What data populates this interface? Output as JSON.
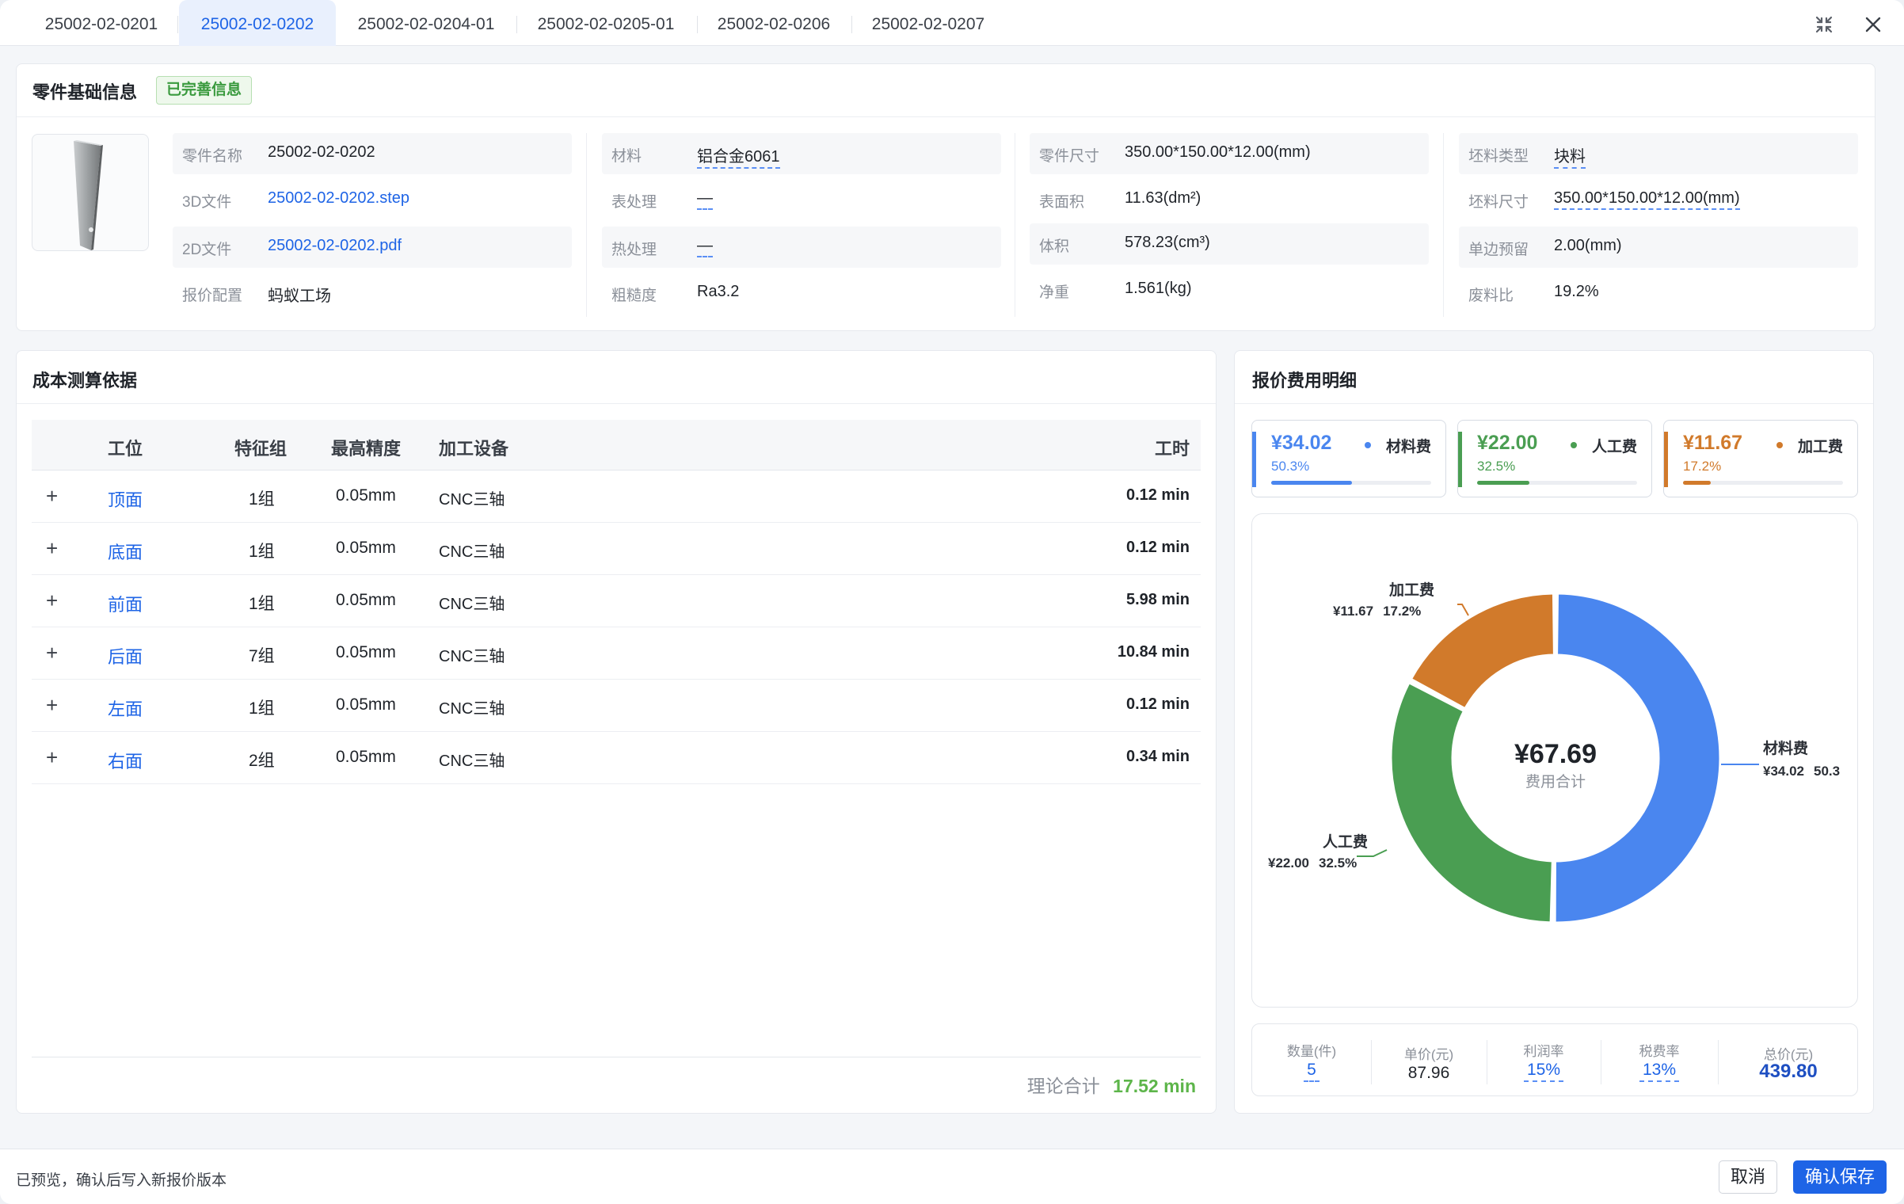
{
  "tabs": [
    {
      "label": "25002-02-0201",
      "active": false
    },
    {
      "label": "25002-02-0202",
      "active": true
    },
    {
      "label": "25002-02-0204-01",
      "active": false
    },
    {
      "label": "25002-02-0205-01",
      "active": false
    },
    {
      "label": "25002-02-0206",
      "active": false
    },
    {
      "label": "25002-02-0207",
      "active": false
    }
  ],
  "basic_info": {
    "title": "零件基础信息",
    "status_badge": "已完善信息",
    "part_name_label": "零件名称",
    "part_name": "25002-02-0202",
    "file3d_label": "3D文件",
    "file3d": "25002-02-0202.step",
    "file2d_label": "2D文件",
    "file2d": "25002-02-0202.pdf",
    "quote_config_label": "报价配置",
    "quote_config": "蚂蚁工场",
    "material_label": "材料",
    "material": "铝合金6061",
    "surface_treatment_label": "表处理",
    "surface_treatment": "—",
    "heat_treatment_label": "热处理",
    "heat_treatment": "—",
    "roughness_label": "粗糙度",
    "roughness": "Ra3.2",
    "part_size_label": "零件尺寸",
    "part_size": "350.00*150.00*12.00(mm)",
    "surface_area_label": "表面积",
    "surface_area": "11.63(dm²)",
    "volume_label": "体积",
    "volume": "578.23(cm³)",
    "net_weight_label": "净重",
    "net_weight": "1.561(kg)",
    "blank_type_label": "坯料类型",
    "blank_type": "块料",
    "blank_size_label": "坯料尺寸",
    "blank_size": "350.00*150.00*12.00(mm)",
    "margin_label": "单边预留",
    "margin": "2.00(mm)",
    "scrap_ratio_label": "废料比",
    "scrap_ratio": "19.2%"
  },
  "cost_basis": {
    "title": "成本测算依据",
    "columns": {
      "station": "工位",
      "feature_group": "特征组",
      "precision": "最高精度",
      "equipment": "加工设备",
      "hours": "工时"
    },
    "rows": [
      {
        "station": "顶面",
        "feature_group": "1组",
        "precision": "0.05mm",
        "equipment": "CNC三轴",
        "hours": "0.12 min"
      },
      {
        "station": "底面",
        "feature_group": "1组",
        "precision": "0.05mm",
        "equipment": "CNC三轴",
        "hours": "0.12 min"
      },
      {
        "station": "前面",
        "feature_group": "1组",
        "precision": "0.05mm",
        "equipment": "CNC三轴",
        "hours": "5.98 min"
      },
      {
        "station": "后面",
        "feature_group": "7组",
        "precision": "0.05mm",
        "equipment": "CNC三轴",
        "hours": "10.84 min"
      },
      {
        "station": "左面",
        "feature_group": "1组",
        "precision": "0.05mm",
        "equipment": "CNC三轴",
        "hours": "0.12 min"
      },
      {
        "station": "右面",
        "feature_group": "2组",
        "precision": "0.05mm",
        "equipment": "CNC三轴",
        "hours": "0.34 min"
      }
    ],
    "total_label": "理论合计",
    "total_value": "17.52 min"
  },
  "quote_detail": {
    "title": "报价费用明细",
    "cost_cards": [
      {
        "amount": "¥34.02",
        "percent": "50.3%",
        "name": "材料费",
        "color": "#4a86ef",
        "fill": 0.503
      },
      {
        "amount": "¥22.00",
        "percent": "32.5%",
        "name": "人工费",
        "color": "#4a9e52",
        "fill": 0.325
      },
      {
        "amount": "¥11.67",
        "percent": "17.2%",
        "name": "加工费",
        "color": "#d17a2b",
        "fill": 0.172
      }
    ],
    "summary": {
      "quantity_label": "数量(件)",
      "quantity": "5",
      "unit_price_label": "单价(元)",
      "unit_price": "87.96",
      "profit_rate_label": "利润率",
      "profit_rate": "15%",
      "tax_rate_label": "税费率",
      "tax_rate": "13%",
      "total_price_label": "总价(元)",
      "total_price": "439.80"
    }
  },
  "chart_data": {
    "type": "pie",
    "center_value": "¥67.69",
    "center_label": "费用合计",
    "slices": [
      {
        "name": "材料费",
        "value": 34.02,
        "value_label": "¥34.02",
        "percent": "50.3",
        "color": "#4a86ef"
      },
      {
        "name": "人工费",
        "value": 22.0,
        "value_label": "¥22.00",
        "percent": "32.5%",
        "color": "#4a9e52"
      },
      {
        "name": "加工费",
        "value": 11.67,
        "value_label": "¥11.67",
        "percent": "17.2%",
        "color": "#d17a2b"
      }
    ]
  },
  "footer": {
    "hint": "已预览，确认后写入新报价版本",
    "cancel_label": "取消",
    "save_label": "确认保存"
  },
  "colors": {
    "accent": "#1e64e6",
    "success": "#3a9a3e",
    "total_green": "#5db54a"
  }
}
